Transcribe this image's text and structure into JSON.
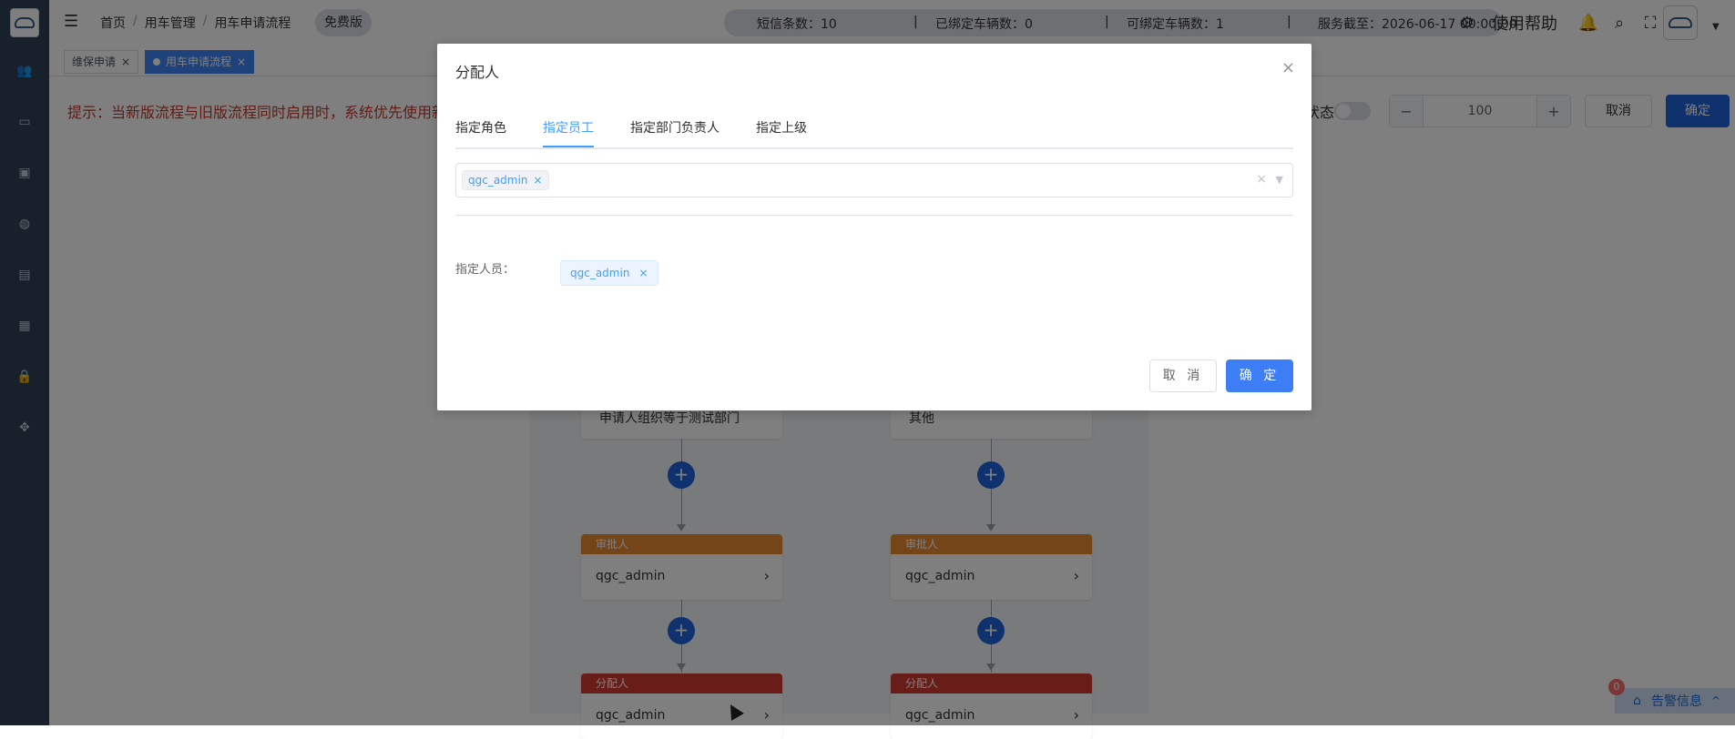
{
  "header": {
    "breadcrumb": [
      "首页",
      "用车管理",
      "用车申请流程"
    ],
    "breadcrumb_sep": "/",
    "free_badge": "免费版",
    "stats": {
      "sms": "短信条数：10",
      "bound": "已绑定车辆数：0",
      "bindable": "可绑定车辆数：1",
      "service": "服务截至：2026-06-17 00:00:00",
      "sep": "|"
    },
    "help": "使用帮助"
  },
  "tabs": {
    "items": [
      {
        "label": "维保申请",
        "close": "×"
      },
      {
        "label": "用车申请流程",
        "close": "×"
      }
    ]
  },
  "main": {
    "tip": "提示：当新版流程与旧版流程同时启用时，系统优先使用新",
    "status_label": "状态",
    "zoom": {
      "minus": "−",
      "value": "100",
      "plus": "+"
    },
    "cancel": "取消",
    "confirm": "确定"
  },
  "flow": {
    "cond_left": "申请人组织等于测试部门",
    "cond_right": "其他",
    "approver_label": "审批人",
    "assignee_label": "分配人",
    "user": "qgc_admin",
    "plus": "+",
    "arrow": "›",
    "colors": {
      "approver": "#ea8b35",
      "assignee": "#d33a33"
    }
  },
  "dialog": {
    "title": "分配人",
    "close": "×",
    "tabs": [
      "指定角色",
      "指定员工",
      "指定部门负责人",
      "指定上级"
    ],
    "active_tab": 1,
    "selected": "qgc_admin",
    "selected_x": "×",
    "clear": "×",
    "caret": "▼",
    "assigned_label": "指定人员：",
    "assigned_tag": "qgc_admin",
    "assigned_x": "×",
    "cancel": "取 消",
    "confirm": "确 定"
  },
  "alert": {
    "badge": "0",
    "label": "告警信息",
    "caret": "^"
  }
}
